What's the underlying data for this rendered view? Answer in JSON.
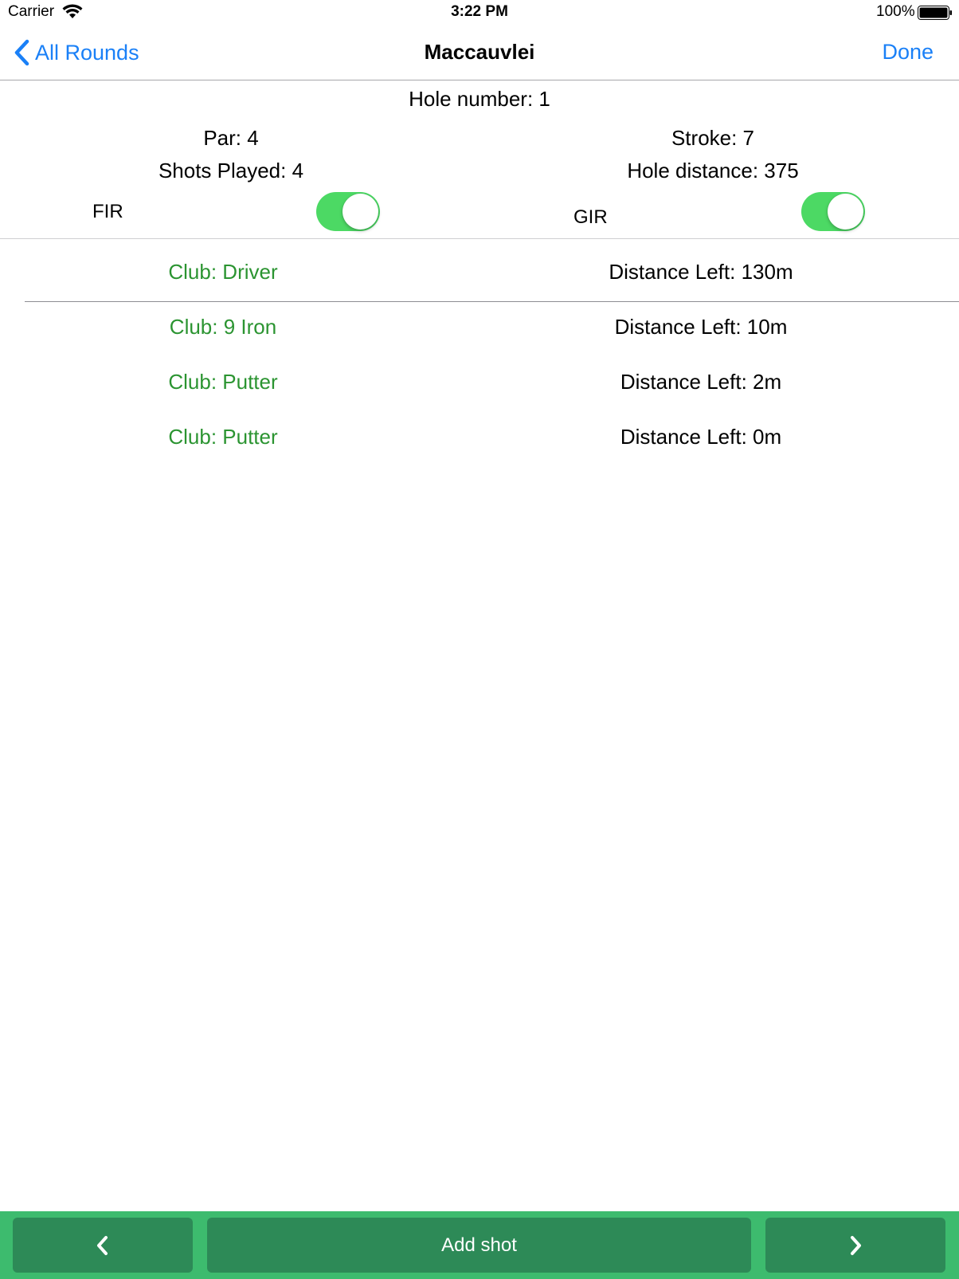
{
  "status_bar": {
    "carrier": "Carrier",
    "time": "3:22 PM",
    "battery": "100%"
  },
  "nav": {
    "back_label": "All Rounds",
    "title": "Maccauvlei",
    "done_label": "Done"
  },
  "hole": {
    "number_text": "Hole number:  1",
    "par_text": "Par:  4",
    "stroke_text": "Stroke:  7",
    "shots_text": "Shots Played:  4",
    "distance_text": "Hole distance:  375",
    "fir_label": "FIR",
    "fir_on": true,
    "gir_label": "GIR",
    "gir_on": true
  },
  "shots": [
    {
      "club": "Club: Driver",
      "distance": "Distance Left: 130m"
    },
    {
      "club": "Club: 9 Iron",
      "distance": "Distance Left: 10m"
    },
    {
      "club": "Club: Putter",
      "distance": "Distance Left: 2m"
    },
    {
      "club": "Club: Putter",
      "distance": "Distance Left: 0m"
    }
  ],
  "toolbar": {
    "add_shot_label": "Add shot",
    "prev_icon": "chevron-left-icon",
    "next_icon": "chevron-right-icon"
  },
  "colors": {
    "accent_blue": "#1a80f7",
    "club_green": "#2b9431",
    "toggle_green": "#4cd964",
    "toolbar_green": "#3dbb6e",
    "button_green": "#2d8a57"
  }
}
